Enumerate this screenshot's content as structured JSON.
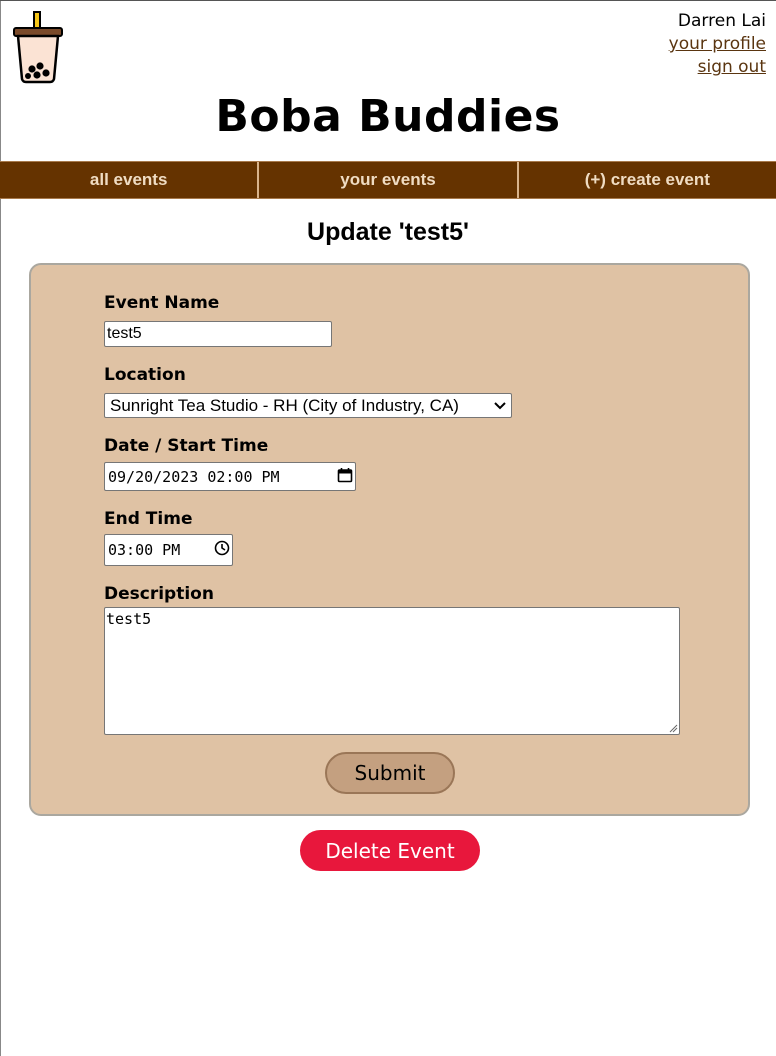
{
  "user": {
    "name": "Darren Lai",
    "profile_link": "your profile",
    "signout_link": "sign out"
  },
  "site": {
    "title": "Boba Buddies",
    "logo_icon": "boba-tea-icon"
  },
  "nav": {
    "items": [
      {
        "label": "all events"
      },
      {
        "label": "your events"
      },
      {
        "label": "(+) create event"
      }
    ]
  },
  "page": {
    "heading": "Update 'test5'"
  },
  "form": {
    "event_name": {
      "label": "Event Name",
      "value": "test5"
    },
    "location": {
      "label": "Location",
      "value": "Sunright Tea Studio - RH (City of Industry, CA)"
    },
    "date_start": {
      "label": "Date / Start Time",
      "value": "09/20/2023 02:00 PM"
    },
    "end_time": {
      "label": "End Time",
      "value": "03:00 PM"
    },
    "description": {
      "label": "Description",
      "value": "test5"
    },
    "submit_label": "Submit"
  },
  "actions": {
    "delete_label": "Delete Event"
  },
  "colors": {
    "nav_bg": "#653300",
    "nav_text": "#f0dcc2",
    "card_bg": "#dfc2a4",
    "submit_bg": "#c4a080",
    "delete_bg": "#e8173c",
    "link": "#5a3510"
  }
}
